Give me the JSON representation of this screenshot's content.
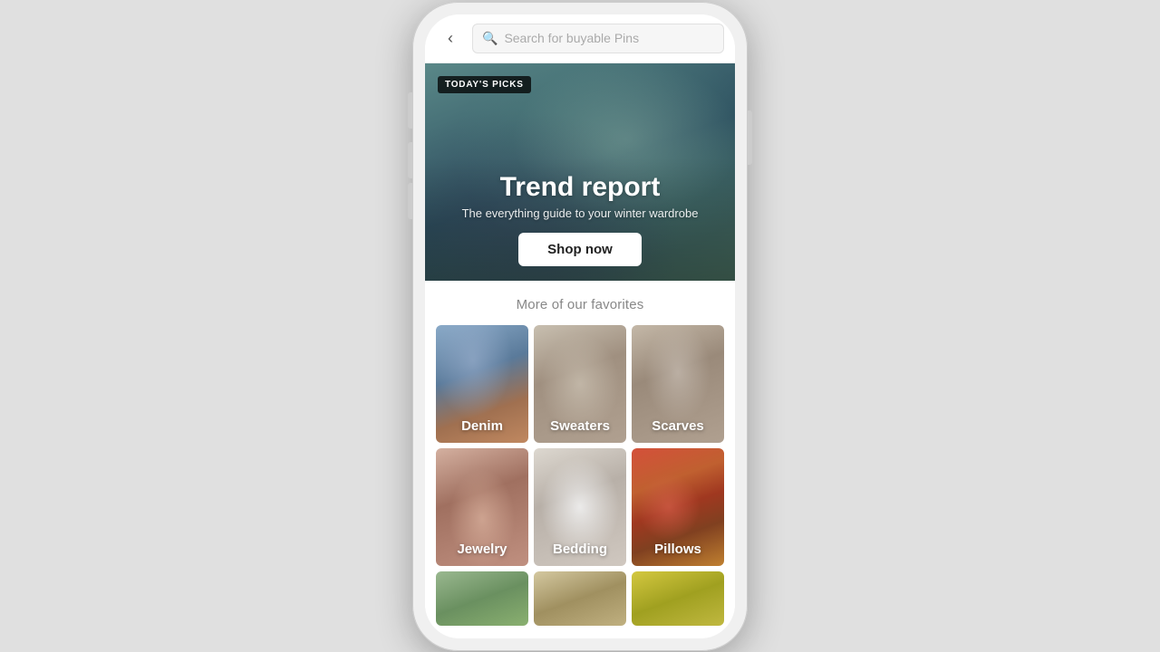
{
  "search": {
    "placeholder": "Search for buyable Pins"
  },
  "hero": {
    "badge": "TODAY'S PICKS",
    "title": "Trend report",
    "subtitle": "The everything guide to your winter wardrobe",
    "cta": "Shop now"
  },
  "section": {
    "favorites_title": "More of our favorites"
  },
  "categories": [
    {
      "id": "denim",
      "label": "Denim",
      "bg_class": "bg-denim"
    },
    {
      "id": "sweaters",
      "label": "Sweaters",
      "bg_class": "bg-sweaters"
    },
    {
      "id": "scarves",
      "label": "Scarves",
      "bg_class": "bg-scarves"
    },
    {
      "id": "jewelry",
      "label": "Jewelry",
      "bg_class": "bg-jewelry"
    },
    {
      "id": "bedding",
      "label": "Bedding",
      "bg_class": "bg-bedding"
    },
    {
      "id": "pillows",
      "label": "Pillows",
      "bg_class": "bg-pillows"
    }
  ],
  "bottom_partials": [
    {
      "id": "partial1",
      "bg_class": "bg-bottom1"
    },
    {
      "id": "partial2",
      "bg_class": "bg-bottom2"
    },
    {
      "id": "partial3",
      "bg_class": "bg-bottom3"
    }
  ]
}
